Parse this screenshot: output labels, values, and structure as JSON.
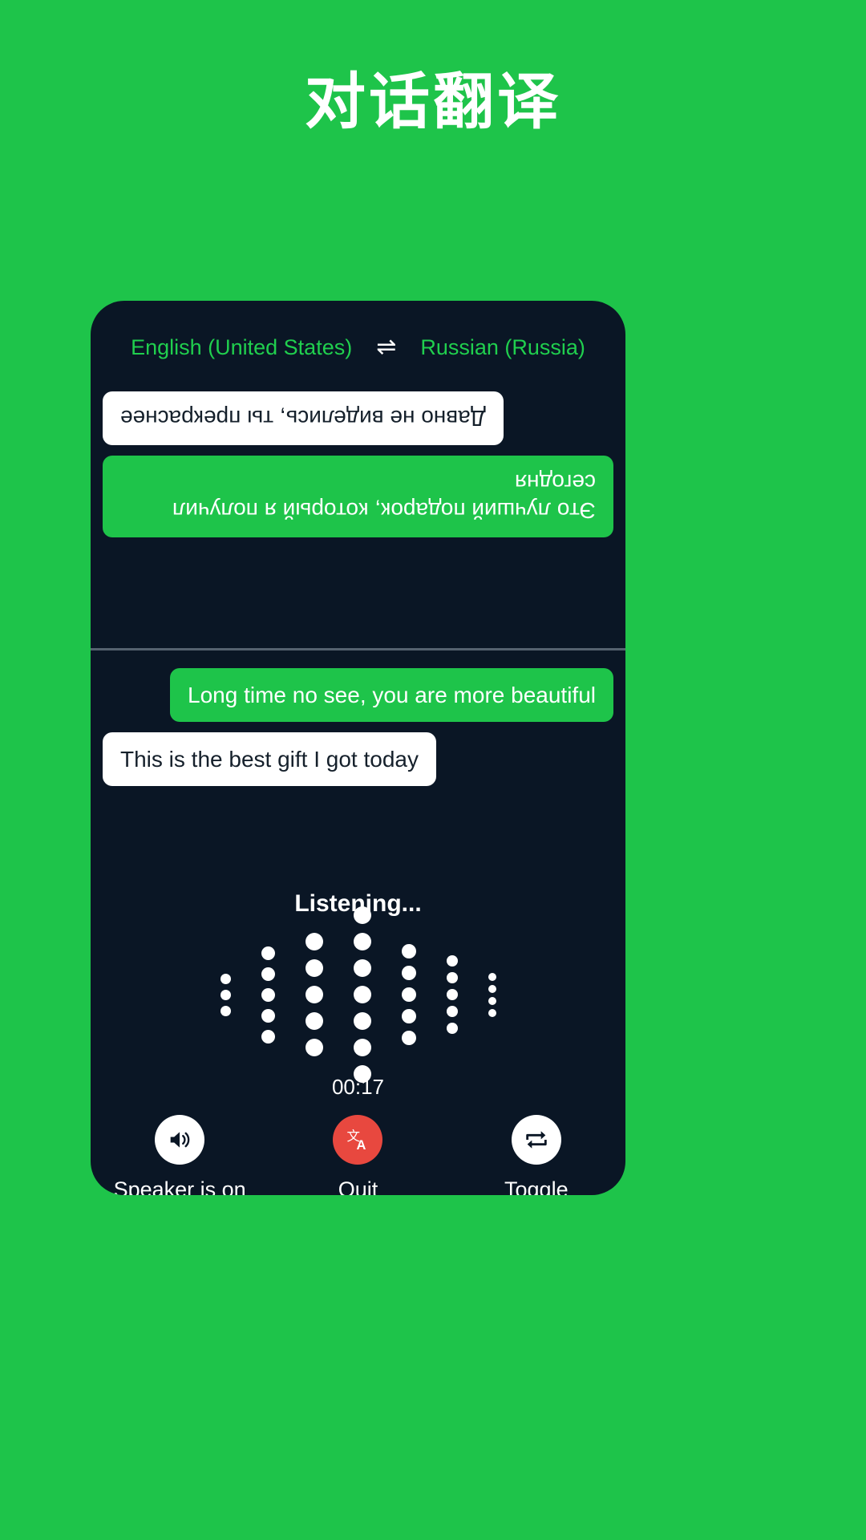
{
  "page": {
    "title": "对话翻译",
    "background_color": "#1ec44a"
  },
  "app": {
    "card_background": "#0a1625",
    "accent_green": "#1ec44a",
    "quit_red": "#e8483f",
    "language_bar": {
      "source_language": "English (United States)",
      "swap_icon": "swap-horizontal-icon",
      "swap_glyph": "⇌",
      "target_language": "Russian (Russia)"
    },
    "conversation": {
      "translated_pane": {
        "orientation": "rotated-180",
        "messages": [
          {
            "text": "Это лучший подарок, который я получил сегодня",
            "style": "green",
            "align": "left"
          },
          {
            "text": "Давно не виделись, ты прекраснее",
            "style": "white",
            "align": "right"
          }
        ]
      },
      "source_pane": {
        "orientation": "normal",
        "messages": [
          {
            "text": "Long time no see, you are more beautiful",
            "style": "green",
            "align": "right"
          },
          {
            "text": "This is the best gift I got today",
            "style": "white",
            "align": "left"
          }
        ]
      }
    },
    "status": {
      "listening_label": "Listening...",
      "timer": "00:17"
    },
    "waveform": {
      "columns": [
        {
          "dots": 3,
          "size": 13
        },
        {
          "dots": 5,
          "size": 17
        },
        {
          "dots": 5,
          "size": 22
        },
        {
          "dots": 7,
          "size": 22
        },
        {
          "dots": 5,
          "size": 18
        },
        {
          "dots": 5,
          "size": 14
        },
        {
          "dots": 4,
          "size": 10
        }
      ]
    },
    "controls": [
      {
        "label": "Speaker is on",
        "icon": "speaker-on-icon",
        "circle_color": "#ffffff",
        "icon_color": "#0a1625"
      },
      {
        "label": "Quit",
        "icon": "translate-icon",
        "circle_color": "#e8483f",
        "icon_color": "#ffffff"
      },
      {
        "label": "Toggle",
        "icon": "swap-repeat-icon",
        "circle_color": "#ffffff",
        "icon_color": "#0a1625"
      }
    ]
  }
}
